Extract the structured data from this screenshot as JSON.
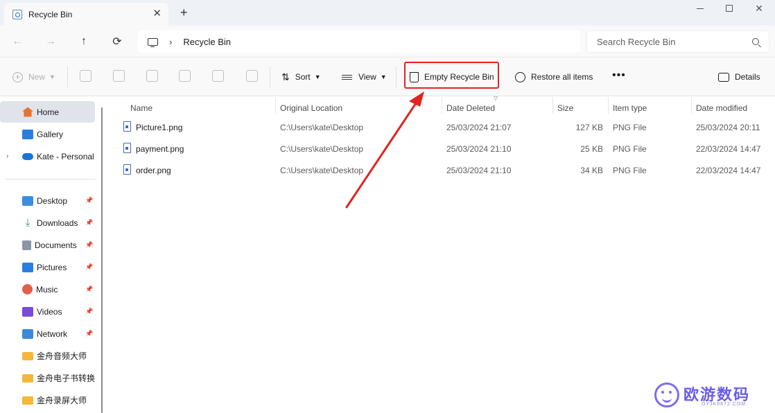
{
  "window": {
    "tab_title": "Recycle Bin",
    "tab_close": "✕",
    "new_tab": "+",
    "minimize": "",
    "maximize": "",
    "close": "✕"
  },
  "nav": {
    "back": "←",
    "forward": "→",
    "up": "↑",
    "refresh": "⟳"
  },
  "address": {
    "separator": "›",
    "path": "Recycle Bin"
  },
  "search": {
    "placeholder": "Search Recycle Bin"
  },
  "toolbar": {
    "new_label": "New",
    "sort_label": "Sort",
    "view_label": "View",
    "empty_label": "Empty Recycle Bin",
    "restore_label": "Restore all items",
    "more_label": "•••",
    "details_label": "Details"
  },
  "sidebar": {
    "top": [
      {
        "label": "Home",
        "icon": "home-icon",
        "color": "#e8742c"
      },
      {
        "label": "Gallery",
        "icon": "gallery-icon",
        "color": "#2a7de1"
      },
      {
        "label": "Kate - Personal",
        "icon": "cloud-icon",
        "color": "#1a73d6"
      }
    ],
    "expand_glyph": "›",
    "pinned": [
      {
        "label": "Desktop",
        "icon": "desktop-icon",
        "color": "#3a8de0"
      },
      {
        "label": "Downloads",
        "icon": "download-icon",
        "color": "#2e9a5a"
      },
      {
        "label": "Documents",
        "icon": "documents-icon",
        "color": "#8a96a8"
      },
      {
        "label": "Pictures",
        "icon": "pictures-icon",
        "color": "#2a7de1"
      },
      {
        "label": "Music",
        "icon": "music-icon",
        "color": "#e0614a"
      },
      {
        "label": "Videos",
        "icon": "videos-icon",
        "color": "#7a4ad8"
      },
      {
        "label": "Network",
        "icon": "network-icon",
        "color": "#3a8ad8"
      },
      {
        "label": "金舟音频大师",
        "icon": "folder-icon",
        "color": "#f3b73a"
      },
      {
        "label": "金舟电子书转换",
        "icon": "folder-icon",
        "color": "#f3b73a"
      },
      {
        "label": "金舟录屏大师",
        "icon": "folder-icon",
        "color": "#f3b73a"
      }
    ],
    "pin_glyph": "📌"
  },
  "columns": {
    "name": "Name",
    "original_location": "Original Location",
    "date_deleted": "Date Deleted",
    "size": "Size",
    "item_type": "Item type",
    "date_modified": "Date modified"
  },
  "files": [
    {
      "name": "Picture1.png",
      "location": "C:\\Users\\kate\\Desktop",
      "deleted": "25/03/2024 21:07",
      "size": "127 KB",
      "type": "PNG File",
      "modified": "25/03/2024 20:11"
    },
    {
      "name": "payment.png",
      "location": "C:\\Users\\kate\\Desktop",
      "deleted": "25/03/2024 21:10",
      "size": "25 KB",
      "type": "PNG File",
      "modified": "22/03/2024 14:47"
    },
    {
      "name": "order.png",
      "location": "C:\\Users\\kate\\Desktop",
      "deleted": "25/03/2024 21:10",
      "size": "34 KB",
      "type": "PNG File",
      "modified": "22/03/2024 14:47"
    }
  ],
  "watermark": {
    "text": "欧游数码",
    "sub": "OYJK6672.COM"
  },
  "colors": {
    "highlight": "#e32222",
    "accent": "#0067c0"
  }
}
